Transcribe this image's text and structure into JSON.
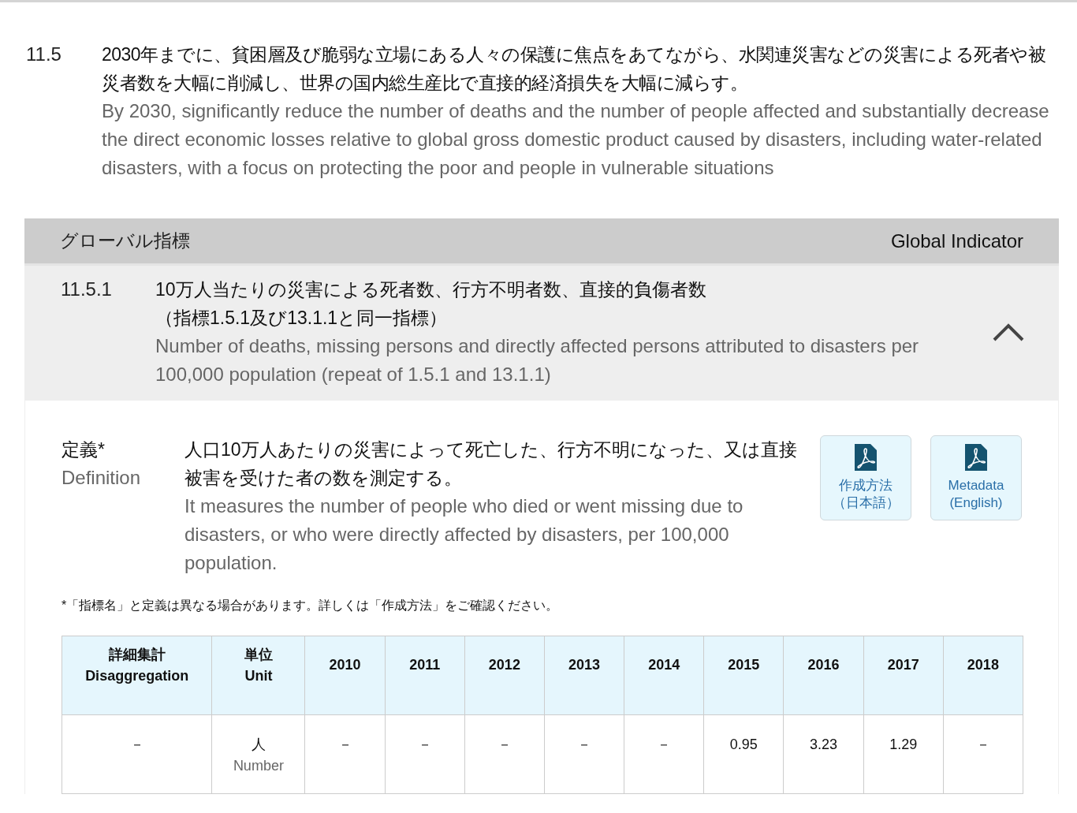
{
  "target": {
    "number": "11.5",
    "text_ja": "2030年までに、貧困層及び脆弱な立場にある人々の保護に焦点をあてながら、水関連災害などの災害による死者や被災者数を大幅に削減し、世界の国内総生産比で直接的経済損失を大幅に減らす。",
    "text_en": "By 2030, significantly reduce the number of deaths and the number of people affected and substantially decrease the direct economic losses relative to global gross domestic product caused by disasters, including water-related disasters, with a focus on protecting the poor and people in vulnerable situations"
  },
  "header": {
    "label_ja": "グローバル指標",
    "label_en": "Global Indicator"
  },
  "indicator": {
    "number": "11.5.1",
    "title_ja": "10万人当たりの災害による死者数、行方不明者数、直接的負傷者数",
    "note_ja": "（指標1.5.1及び13.1.1と同一指標）",
    "title_en": "Number of deaths, missing persons and directly affected persons attributed to disasters per 100,000 population (repeat of 1.5.1 and 13.1.1)",
    "expanded": true
  },
  "definition": {
    "label_ja": "定義*",
    "label_en": "Definition",
    "text_ja": "人口10万人あたりの災害によって死亡した、行方不明になった、又は直接被害を受けた者の数を測定する。",
    "text_en": "It measures the number of people who died or went missing due to disasters, or who were directly affected by disasters, per 100,000 population."
  },
  "buttons": [
    {
      "line1": "作成方法",
      "line2": "（日本語）"
    },
    {
      "line1": "Metadata",
      "line2": "(English)"
    }
  ],
  "footnote": "*「指標名」と定義は異なる場合があります。詳しくは「作成方法」をご確認ください。",
  "table": {
    "columns": [
      {
        "ja": "詳細集計",
        "en": "Disaggregation"
      },
      {
        "ja": "単位",
        "en": "Unit"
      },
      {
        "en": "2010"
      },
      {
        "en": "2011"
      },
      {
        "en": "2012"
      },
      {
        "en": "2013"
      },
      {
        "en": "2014"
      },
      {
        "en": "2015"
      },
      {
        "en": "2016"
      },
      {
        "en": "2017"
      },
      {
        "en": "2018"
      }
    ],
    "rows": [
      {
        "disaggregation": "－",
        "unit_ja": "人",
        "unit_en": "Number",
        "values": [
          "－",
          "－",
          "－",
          "－",
          "－",
          "0.95",
          "3.23",
          "1.29",
          "－"
        ]
      }
    ]
  }
}
